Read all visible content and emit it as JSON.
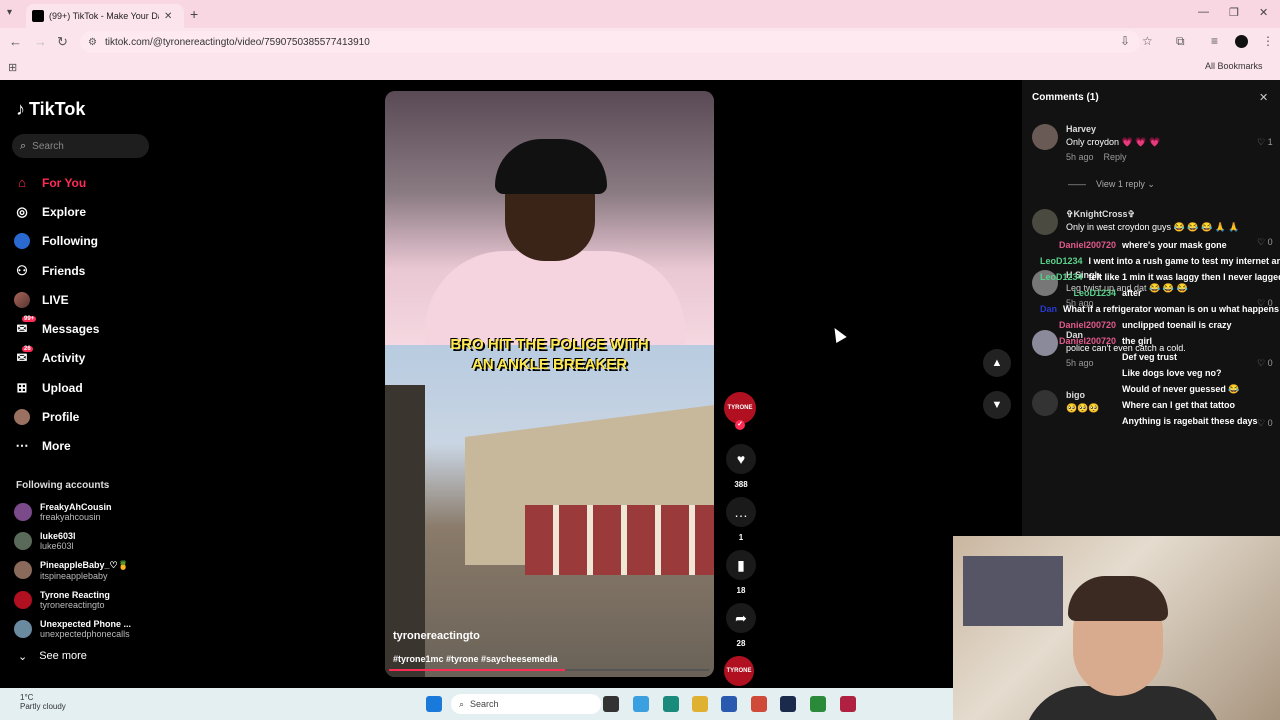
{
  "browser": {
    "tab_title": "(99+) TikTok - Make Your Day",
    "url": "tiktok.com/@tyronereactingto/video/7590750385577413910",
    "all_bookmarks": "All Bookmarks"
  },
  "sidebar": {
    "logo": "TikTok",
    "search_placeholder": "Search",
    "nav": [
      {
        "label": "For You",
        "icon": "home-icon"
      },
      {
        "label": "Explore",
        "icon": "compass-icon"
      },
      {
        "label": "Following",
        "icon": "following-icon"
      },
      {
        "label": "Friends",
        "icon": "friends-icon"
      },
      {
        "label": "LIVE",
        "icon": "live-icon"
      },
      {
        "label": "Messages",
        "icon": "messages-icon",
        "badge": "99+"
      },
      {
        "label": "Activity",
        "icon": "activity-icon",
        "badge": "26"
      },
      {
        "label": "Upload",
        "icon": "upload-icon"
      },
      {
        "label": "Profile",
        "icon": "profile-icon"
      },
      {
        "label": "More",
        "icon": "more-icon"
      }
    ],
    "following_header": "Following accounts",
    "following": [
      {
        "name": "FreakyAhCousin",
        "handle": "freakyahcousin",
        "color": "#7a4a8a"
      },
      {
        "name": "luke603l",
        "handle": "luke603l",
        "color": "#5a6a5a"
      },
      {
        "name": "PineappleBaby_♡🍍",
        "handle": "itspineapplebaby",
        "color": "#8a6a5a"
      },
      {
        "name": "Tyrone Reacting",
        "handle": "tyronereactingto",
        "color": "#b01020"
      },
      {
        "name": "Unexpected Phone ...",
        "handle": "unexpectedphonecalls",
        "color": "#6a8aa0"
      }
    ],
    "see_more": "See more"
  },
  "video": {
    "caption_line1": "BRO HIT THE POLICE WITH",
    "caption_line2": "AN ANKLE BREAKER",
    "author": "tyronereactingto",
    "tags": "#tyrone1mc #tyrone #saycheesemedia",
    "progress": 0.55
  },
  "actions": {
    "avatar_text": "TYRONE",
    "likes": "388",
    "comments": "1",
    "saves": "18",
    "shares": "28"
  },
  "comments_panel": {
    "title": "Comments (1)",
    "comments": [
      {
        "name": "Harvey",
        "text": "Only croydon 💗 💗 💗",
        "time": "5h ago",
        "reply": "Reply",
        "likes": "1"
      },
      {
        "name": "✞KnightCross✞",
        "text": "Only in west croydon guys 😂 😂 😂 🙏 🙏",
        "time": "",
        "reply": "",
        "likes": "0"
      },
      {
        "name": "H Singh",
        "text": "Leg twist up and dat 😂 😂 😂",
        "time": "5h ago",
        "reply": "Reply",
        "likes": "0"
      },
      {
        "name": "Dan",
        "text": "police can't even catch a cold.",
        "time": "5h ago",
        "reply": "Reply",
        "likes": "0"
      },
      {
        "name": "bigo",
        "text": "🥺🥺🥺",
        "time": "5h ago",
        "reply": "Reply",
        "likes": "0"
      }
    ],
    "view_reply": "View 1 reply"
  },
  "chat_overlay": [
    {
      "user": "Daniel200720",
      "msg": "where's your mask gone",
      "color": "#e05a8a"
    },
    {
      "user": "LeoD1234",
      "msg": "I went into a rush game to test my internet and it's good",
      "color": "#5ad08a"
    },
    {
      "user": "LeoD1234",
      "msg": "felt like 1 min it was laggy then I never lagged onces faster",
      "color": "#5ad08a"
    },
    {
      "user": "LeoD1234",
      "msg": "after",
      "color": "#5ad08a"
    },
    {
      "user": "Dan",
      "msg": "What if a refrigerator woman is on u what happens then",
      "color": "#2a3ad0"
    },
    {
      "user": "Daniel200720",
      "msg": "unclipped toenail is crazy",
      "color": "#e05a8a"
    },
    {
      "user": "Daniel200720",
      "msg": "the girl",
      "color": "#e05a8a"
    },
    {
      "user": "",
      "msg": "Def veg trust",
      "color": "#2a3ad0"
    },
    {
      "user": "",
      "msg": "Like dogs love veg no?",
      "color": "#2a3ad0"
    },
    {
      "user": "",
      "msg": "Would of never guessed 😂",
      "color": "#2a3ad0"
    },
    {
      "user": "",
      "msg": "Where can I get that tattoo",
      "color": "#2a3ad0"
    },
    {
      "user": "",
      "msg": "Anything is ragebait these days",
      "color": "#2a3ad0"
    }
  ],
  "taskbar": {
    "temp": "1°C",
    "weather": "Partly cloudy",
    "search": "Search"
  }
}
